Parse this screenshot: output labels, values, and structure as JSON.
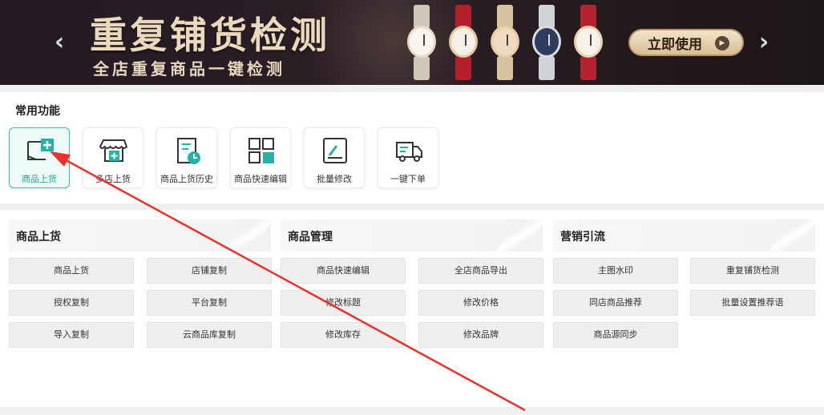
{
  "banner": {
    "title": "重复铺货检测",
    "subtitle": "全店重复商品一键检测",
    "cta_label": "立即使用",
    "cta_icon": "play-icon",
    "prev_icon": "chevron-left-icon",
    "next_icon": "chevron-right-icon",
    "colors": {
      "background": "#251b21",
      "title": "#ead9bd",
      "cta": "#e6d0aa"
    }
  },
  "common": {
    "heading": "常用功能",
    "tiles": [
      {
        "label": "商品上货",
        "icon": "add-product-icon",
        "active": true
      },
      {
        "label": "多店上货",
        "icon": "store-add-icon",
        "active": false
      },
      {
        "label": "商品上货历史",
        "icon": "history-icon",
        "active": false
      },
      {
        "label": "商品快速编辑",
        "icon": "grid-edit-icon",
        "active": false
      },
      {
        "label": "批量修改",
        "icon": "batch-edit-icon",
        "active": false
      },
      {
        "label": "一键下单",
        "icon": "truck-icon",
        "active": false
      }
    ],
    "accent_color": "#1aa89a"
  },
  "groups": [
    {
      "title": "商品上货",
      "buttons": [
        "商品上货",
        "店铺复制",
        "授权复制",
        "平台复制",
        "导入复制",
        "云商品库复制"
      ]
    },
    {
      "title": "商品管理",
      "buttons": [
        "商品快速编辑",
        "全店商品导出",
        "修改标题",
        "修改价格",
        "修改库存",
        "修改品牌"
      ]
    },
    {
      "title": "营销引流",
      "buttons": [
        "主图水印",
        "重复铺货检测",
        "同店商品推荐",
        "批量设置推荐语",
        "商品源同步"
      ]
    }
  ],
  "annotation": {
    "color": "#e8322b"
  }
}
